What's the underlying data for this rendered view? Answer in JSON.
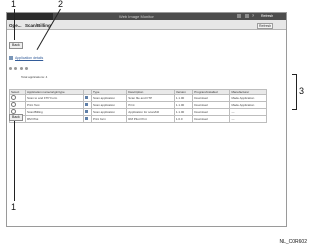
{
  "topbar": {
    "title": "Web Image Monitor",
    "links": [
      "?",
      "Refresh"
    ]
  },
  "tabs": {
    "left": "Ope...",
    "active": "Scan/Billing"
  },
  "toolbar": {
    "btn_label": "Back"
  },
  "actions": {
    "detail_link": "Application details",
    "refresh_link": "Refresh"
  },
  "section": {
    "label": "Total applications: 4"
  },
  "table": {
    "columns": [
      "Select",
      "Application name/origin/type",
      "",
      "Type",
      "Status",
      "Description",
      "Version",
      "Program/installed",
      "Manufacturer"
    ],
    "rows": [
      [
        "Scan to and FTP Form",
        "Scan application",
        "Scan file and FTP",
        "1.1.00",
        "Download",
        "Made Application"
      ],
      [
        "Print Test",
        "Scan application",
        "Print",
        "1.1.00",
        "Download",
        "Made Application"
      ],
      [
        "Scan/Billing",
        "Scan application",
        "Application for scan/bill",
        "1.1.00",
        "Download",
        "—"
      ],
      [
        "RM Pilot",
        "Print form",
        "RM Pilot Print",
        "1.0.0",
        "Download",
        "—"
      ]
    ]
  },
  "footer_btn": "Back",
  "callouts": [
    "1",
    "2",
    "3",
    "1"
  ],
  "figure_code": "NL_C0R602"
}
